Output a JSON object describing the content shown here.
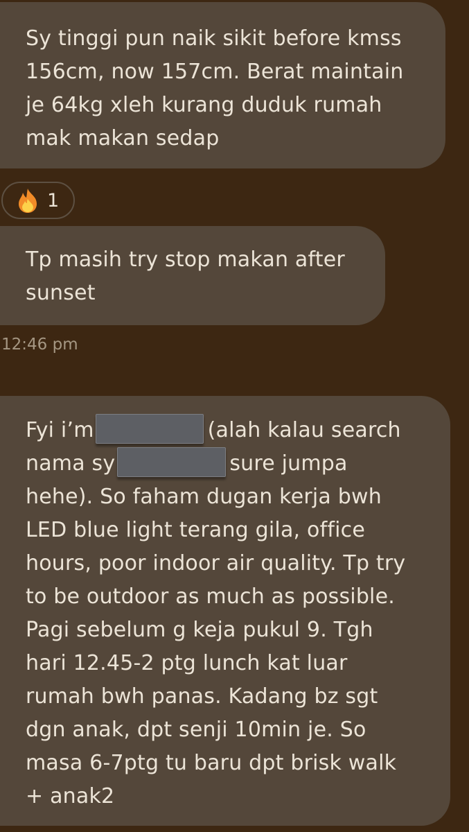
{
  "messages": {
    "m1": {
      "lines": [
        "Sy tinggi pun naik sikit before kmss",
        "156cm, now 157cm. Berat maintain",
        "je 64kg xleh kurang duduk rumah",
        "mak makan sedap"
      ]
    },
    "reaction": {
      "icon": "fire-emoji-icon",
      "count": "1"
    },
    "m2": {
      "lines": [
        "Tp masih try stop makan after",
        "sunset"
      ]
    },
    "timestamp": "12:46 pm",
    "m3": {
      "line1_a": "Fyi i’m",
      "line1_b": "(alah kalau search",
      "line2_a": "nama sy",
      "line2_b": "sure jumpa",
      "lines": [
        "hehe). So faham dugan kerja bwh",
        "LED blue light terang gila, office",
        "hours, poor indoor air quality. Tp try",
        "to be outdoor as much as possible.",
        "Pagi sebelum g keja pukul 9. Tgh",
        "hari 12.45-2 ptg lunch kat luar",
        "rumah bwh panas. Kadang bz sgt",
        "dgn anak, dpt senji 10min je. So",
        "masa 6-7ptg tu baru dpt brisk walk",
        "+ anak2"
      ]
    }
  },
  "colors": {
    "background": "#3d2712",
    "bubble": "#54473a",
    "text": "#ece4d7",
    "timestamp": "#a59783"
  }
}
